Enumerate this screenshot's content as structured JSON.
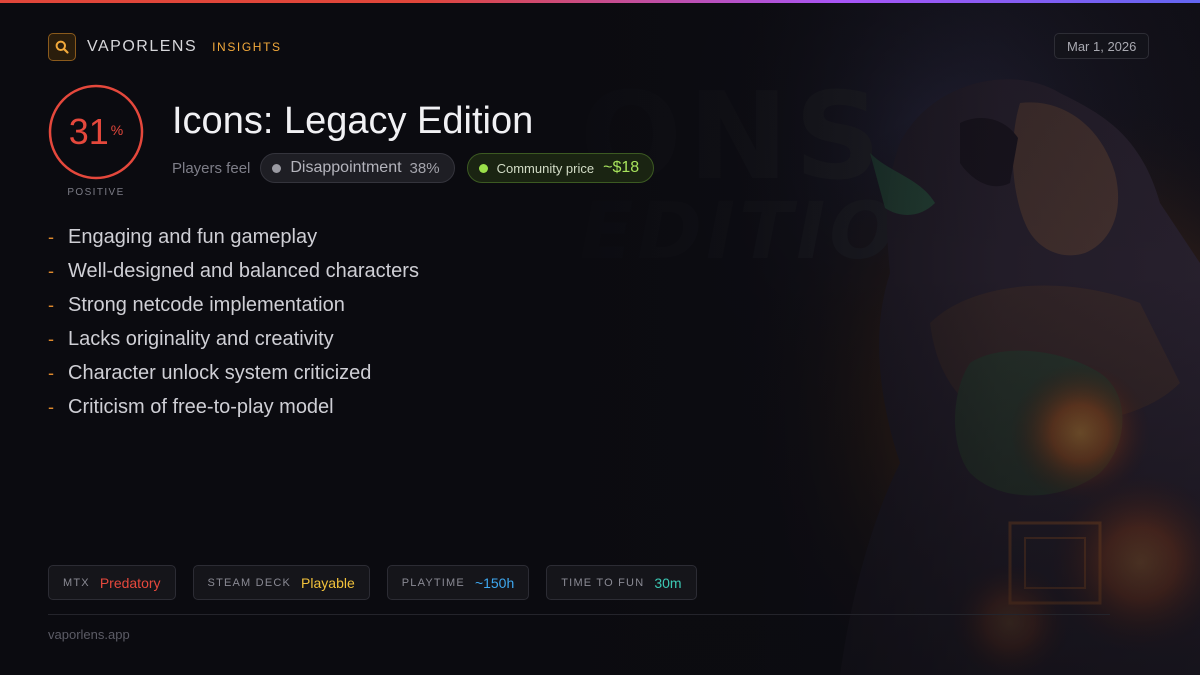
{
  "header": {
    "brand": "VAPORLENS",
    "section": "INSIGHTS",
    "date": "Mar 1, 2026"
  },
  "score": {
    "value": "31",
    "unit": "%",
    "fraction": 0.31,
    "label": "POSITIVE",
    "color": "#e5483c"
  },
  "game": {
    "title": "Icons: Legacy Edition"
  },
  "sentiment": {
    "label": "Players feel",
    "feeling": "Disappointment",
    "feeling_pct": "38%",
    "price_label": "Community price",
    "price_value": "~$18"
  },
  "points": [
    "Engaging and fun gameplay",
    "Well-designed and balanced characters",
    "Strong netcode implementation",
    "Lacks originality and creativity",
    "Character unlock system criticized",
    "Criticism of free-to-play model"
  ],
  "stats": [
    {
      "label": "MTX",
      "value": "Predatory",
      "color": "#e5483c"
    },
    {
      "label": "STEAM DECK",
      "value": "Playable",
      "color": "#f2c23b"
    },
    {
      "label": "PLAYTIME",
      "value": "~150h",
      "color": "#3ea8f0"
    },
    {
      "label": "TIME TO FUN",
      "value": "30m",
      "color": "#3cc9b4"
    }
  ],
  "footer": {
    "site": "vaporlens.app"
  },
  "background_art": {
    "watermark_text": "ONS EDITION"
  },
  "icons": {
    "logo": "search-icon"
  }
}
